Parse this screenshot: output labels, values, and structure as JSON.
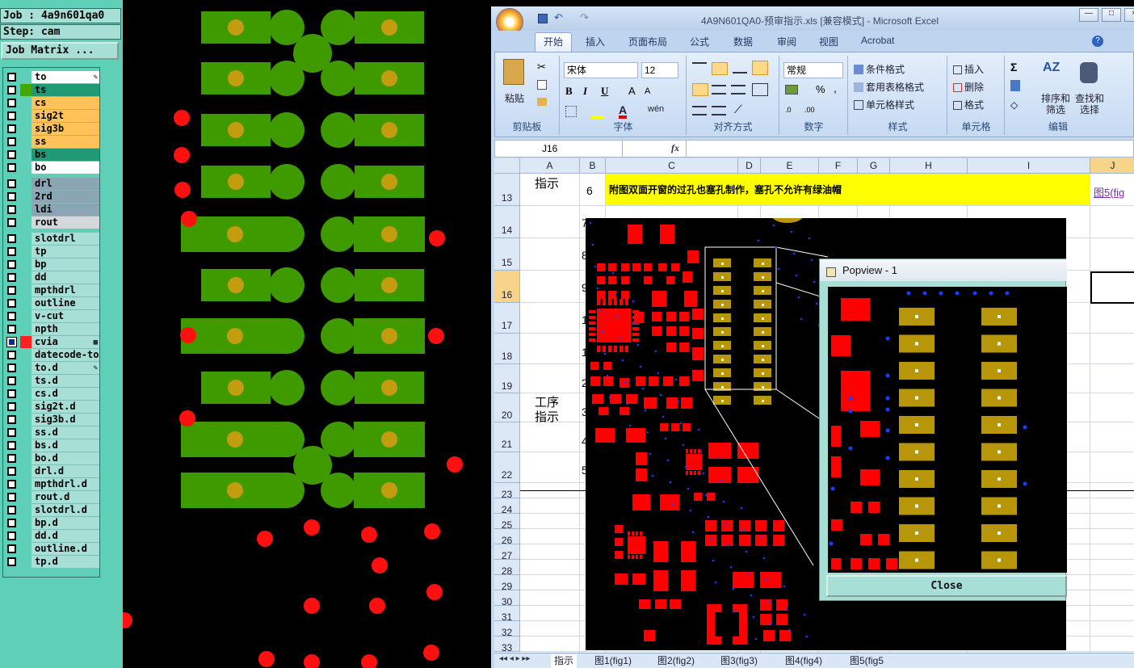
{
  "left_panel": {
    "job": "Job : 4a9n601qa0",
    "step": "Step: cam",
    "matrix_button": "Job Matrix ...",
    "layers": [
      {
        "name": "to",
        "color": "#ffffff",
        "checked": false,
        "mark": "pencil-icon"
      },
      {
        "name": "ts",
        "color": "#1f9a74",
        "checked": false,
        "swatch": "#44a800"
      },
      {
        "name": "cs",
        "color": "#ffc35a",
        "checked": false
      },
      {
        "name": "sig2t",
        "color": "#ffc35a",
        "checked": false
      },
      {
        "name": "sig3b",
        "color": "#ffc35a",
        "checked": false
      },
      {
        "name": "ss",
        "color": "#ffc35a",
        "checked": false
      },
      {
        "name": "bs",
        "color": "#1f9a74",
        "checked": false
      },
      {
        "name": "bo",
        "color": "#ffffff",
        "checked": false
      },
      {
        "name": "drl",
        "color": "#8aa6b4",
        "checked": false
      },
      {
        "name": "2rd",
        "color": "#8aa6b4",
        "checked": false
      },
      {
        "name": "ldi",
        "color": "#8aa6b4",
        "checked": false
      },
      {
        "name": "rout",
        "color": "#d3d8dc",
        "checked": false
      },
      {
        "name": "slotdrl",
        "color": "#a7dfd6",
        "checked": false
      },
      {
        "name": "tp",
        "color": "#a7dfd6",
        "checked": false
      },
      {
        "name": "bp",
        "color": "#a7dfd6",
        "checked": false
      },
      {
        "name": "dd",
        "color": "#a7dfd6",
        "checked": false
      },
      {
        "name": "mpthdrl",
        "color": "#a7dfd6",
        "checked": false
      },
      {
        "name": "outline",
        "color": "#a7dfd6",
        "checked": false
      },
      {
        "name": "v-cut",
        "color": "#a7dfd6",
        "checked": false
      },
      {
        "name": "npth",
        "color": "#a7dfd6",
        "checked": false
      },
      {
        "name": "cvia",
        "color": "#a7dfd6",
        "checked": true,
        "swatch": "#ff2020",
        "mark": "grid-icon"
      },
      {
        "name": "datecode-to",
        "color": "#a7dfd6",
        "checked": false
      },
      {
        "name": "to.d",
        "color": "#a7dfd6",
        "checked": false,
        "mark": "pencil-icon"
      },
      {
        "name": "ts.d",
        "color": "#a7dfd6",
        "checked": false
      },
      {
        "name": "cs.d",
        "color": "#a7dfd6",
        "checked": false
      },
      {
        "name": "sig2t.d",
        "color": "#a7dfd6",
        "checked": false
      },
      {
        "name": "sig3b.d",
        "color": "#a7dfd6",
        "checked": false
      },
      {
        "name": "ss.d",
        "color": "#a7dfd6",
        "checked": false
      },
      {
        "name": "bs.d",
        "color": "#a7dfd6",
        "checked": false
      },
      {
        "name": "bo.d",
        "color": "#a7dfd6",
        "checked": false
      },
      {
        "name": "drl.d",
        "color": "#a7dfd6",
        "checked": false
      },
      {
        "name": "mpthdrl.d",
        "color": "#a7dfd6",
        "checked": false
      },
      {
        "name": "rout.d",
        "color": "#a7dfd6",
        "checked": false
      },
      {
        "name": "slotdrl.d",
        "color": "#a7dfd6",
        "checked": false
      },
      {
        "name": "bp.d",
        "color": "#a7dfd6",
        "checked": false
      },
      {
        "name": "dd.d",
        "color": "#a7dfd6",
        "checked": false
      },
      {
        "name": "outline.d",
        "color": "#a7dfd6",
        "checked": false
      },
      {
        "name": "tp.d",
        "color": "#a7dfd6",
        "checked": false
      }
    ]
  },
  "excel": {
    "title": "4A9N601QA0-预审指示.xls  [兼容模式] - Microsoft Excel",
    "tabs": [
      "开始",
      "插入",
      "页面布局",
      "公式",
      "数据",
      "审阅",
      "视图",
      "Acrobat"
    ],
    "ribbon": {
      "clipboard": {
        "label": "剪贴板",
        "paste": "粘贴"
      },
      "font": {
        "label": "字体",
        "family": "宋体",
        "size": "12"
      },
      "align": {
        "label": "对齐方式"
      },
      "number": {
        "label": "数字",
        "format": "常规"
      },
      "styles": {
        "label": "样式",
        "cond": "条件格式",
        "table": "套用表格格式",
        "cell": "单元格样式"
      },
      "cells": {
        "label": "单元格",
        "insert": "插入",
        "delete": "删除",
        "format": "格式"
      },
      "edit": {
        "label": "编辑",
        "sort": "排序和",
        "sort2": "筛选",
        "find": "查找和",
        "find2": "选择"
      }
    },
    "name_box": "J16",
    "fx": "fx",
    "columns": [
      "A",
      "B",
      "C",
      "D",
      "E",
      "F",
      "G",
      "H",
      "I",
      "J"
    ],
    "rows": [
      "13",
      "14",
      "15",
      "16",
      "17",
      "18",
      "19",
      "20",
      "21",
      "22",
      "23",
      "24",
      "25",
      "26",
      "27",
      "28",
      "29",
      "30",
      "31",
      "32",
      "33"
    ],
    "cells": {
      "a13": "指示",
      "b13": "6",
      "c13": "附图双面开窗的过孔也塞孔制作，塞孔不允许有绿油帽",
      "j13": "图5(fig",
      "a_proc": "工序",
      "a_proc2": "指示",
      "b_list": [
        "7",
        "8",
        "9",
        "1",
        "1",
        "2",
        "3",
        "4",
        "5"
      ]
    },
    "sheet_tabs": [
      "指示",
      "图1(fig1)",
      "图2(fig2)",
      "图3(fig3)",
      "图4(fig4)",
      "图5(fig5"
    ]
  },
  "popview": {
    "title": "Popview - 1",
    "close": "Close"
  }
}
